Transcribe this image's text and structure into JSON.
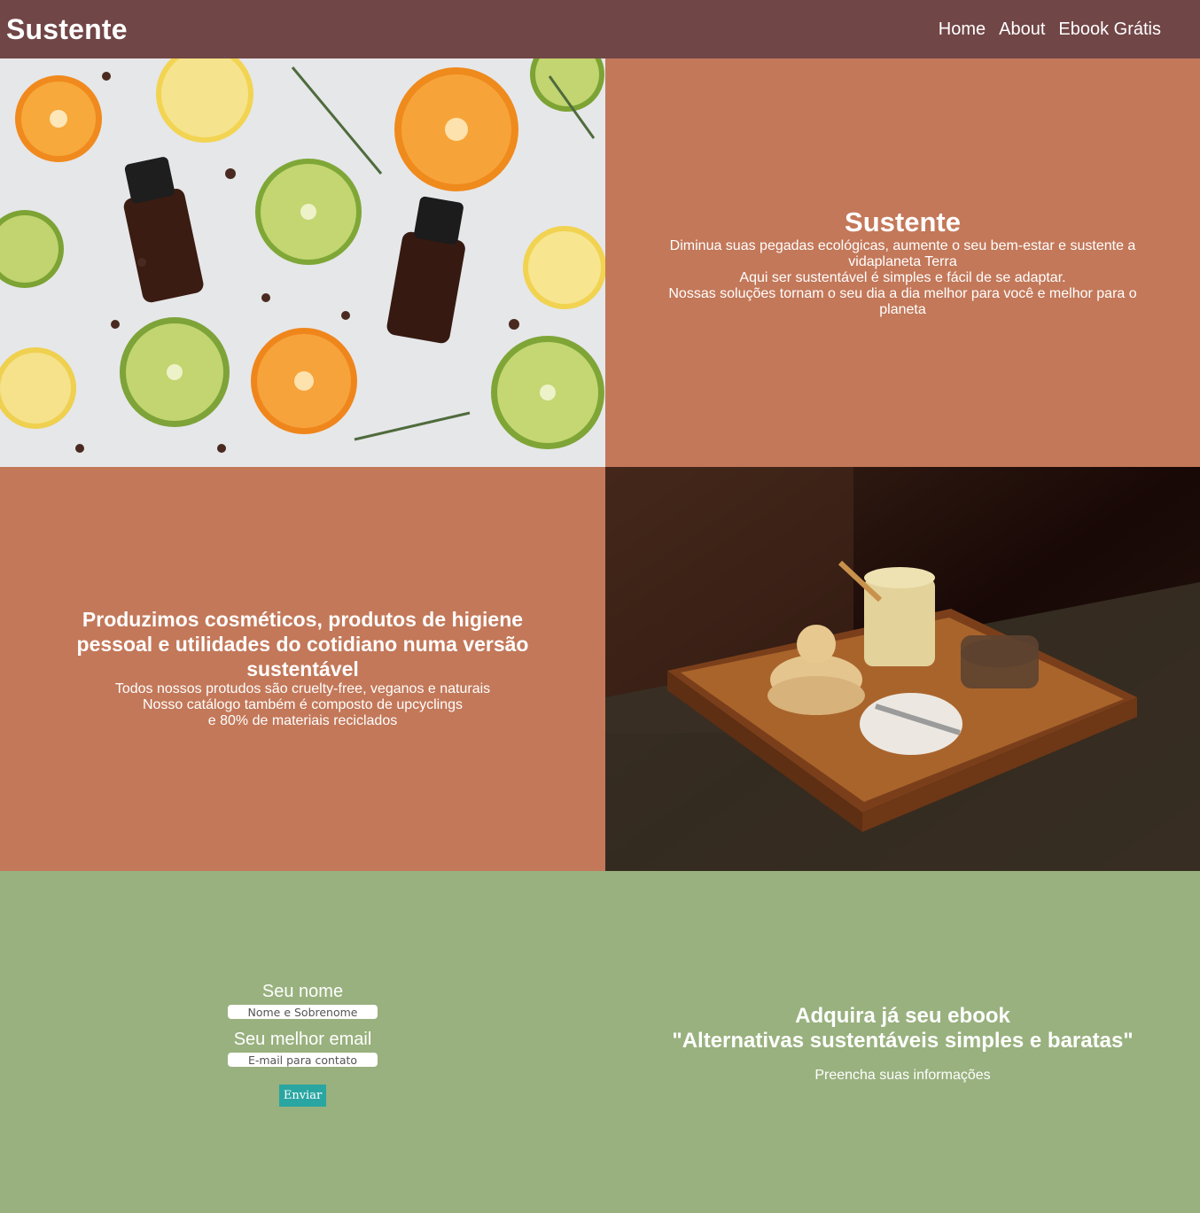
{
  "header": {
    "brand": "Sustente",
    "nav": [
      "Home",
      "About",
      "Ebook Grátis"
    ]
  },
  "hero": {
    "title": "Sustente",
    "lines": [
      "Diminua suas pegadas ecológicas, aumente o seu bem-estar e sustente a vidaplaneta Terra",
      "Aqui ser sustentável é simples e fácil de se adaptar.",
      "Nossas soluções tornam o seu dia a dia melhor para você e melhor para o planeta"
    ]
  },
  "products": {
    "title": "Produzimos cosméticos, produtos de higiene pessoal e utilidades do cotidiano numa versão sustentável",
    "lines": [
      "Todos nossos protudos são cruelty-free, veganos e naturais",
      "Nosso catálogo também é composto de upcyclings",
      "e 80% de materiais reciclados"
    ]
  },
  "form": {
    "name_label": "Seu nome",
    "name_placeholder": "Nome e Sobrenome",
    "email_label": "Seu melhor email",
    "email_placeholder": "E-mail para contato",
    "submit": "Enviar"
  },
  "ebook": {
    "title_line1": "Adquira já seu ebook",
    "title_line2": "\"Alternativas sustentáveis simples e baratas\"",
    "subtitle": "Preencha suas informações"
  },
  "colors": {
    "header": "#714646",
    "terracotta": "#c37859",
    "green": "#99b17e",
    "button": "#2aa6a2"
  }
}
